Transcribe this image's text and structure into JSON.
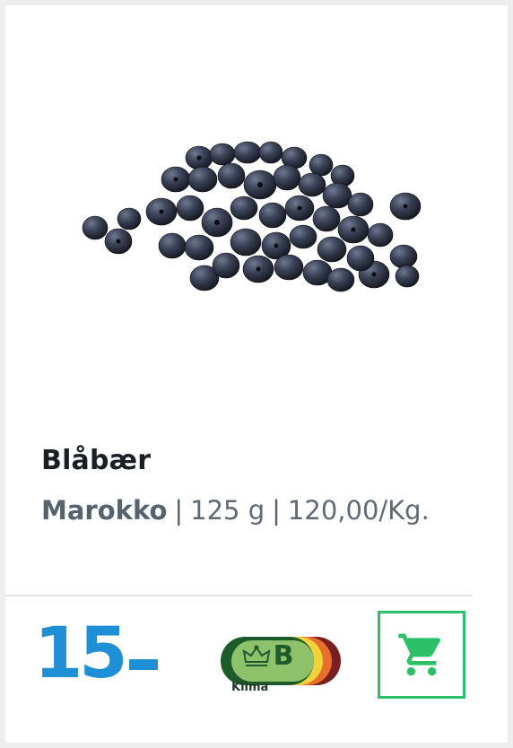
{
  "product": {
    "name": "Blåbær",
    "origin": "Marokko",
    "separator": "|",
    "size": "125 g",
    "unit_price": "120,00/Kg."
  },
  "price": {
    "amount": "15"
  },
  "climate": {
    "grade": "B",
    "label": "Klima",
    "icon": "crown-icon",
    "colors": [
      "#1e5b2b",
      "#8dc26b",
      "#f0d23a",
      "#e96d2d",
      "#7a1f1f"
    ]
  },
  "cart": {
    "icon": "shopping-cart-icon",
    "accent_color": "#2bc067"
  },
  "colors": {
    "price": "#1f8fd6",
    "title": "#1a1f24",
    "subtitle": "#5e6a78"
  }
}
